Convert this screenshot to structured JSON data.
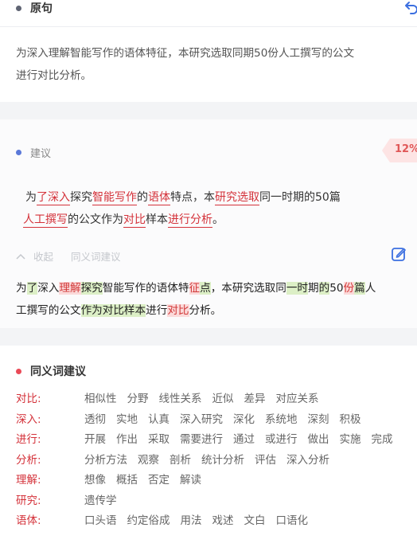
{
  "original": {
    "title": "原句",
    "lines": [
      "为深入理解智能写作的语体特征，本研究选取同期50份人工撰写的公文",
      "进行对比分析。"
    ]
  },
  "suggestion": {
    "label": "建议",
    "percent": "12%",
    "line1": [
      {
        "t": "为"
      },
      {
        "t": "了",
        "u": true
      },
      {
        "t": "深入",
        "u": true
      },
      {
        "t": "探究"
      },
      {
        "t": "智能写作",
        "u": true
      },
      {
        "t": "的"
      },
      {
        "t": "语体",
        "u": true
      },
      {
        "t": "特点，本"
      },
      {
        "t": "研究选取",
        "u": true
      },
      {
        "t": "同一时期的50篇"
      }
    ],
    "line2": [
      {
        "t": "人工撰写",
        "u": true
      },
      {
        "t": "的公文作为"
      },
      {
        "t": "对比",
        "u": true
      },
      {
        "t": "样本"
      },
      {
        "t": "进行分析",
        "u": true
      },
      {
        "t": "。"
      }
    ],
    "collapse_label": "收起",
    "synonym_tab_label": "同义词建议"
  },
  "diff": {
    "line1": [
      {
        "t": "为"
      },
      {
        "t": "了",
        "k": "ins"
      },
      {
        "t": "深入"
      },
      {
        "t": "理解",
        "k": "del"
      },
      {
        "t": "探究",
        "k": "ins"
      },
      {
        "t": "智能写作的语体特"
      },
      {
        "t": "征",
        "k": "del"
      },
      {
        "t": "点",
        "k": "ins"
      },
      {
        "t": "，本研究选取同"
      },
      {
        "t": "一时",
        "k": "ins"
      },
      {
        "t": "期"
      },
      {
        "t": "的",
        "k": "ins"
      },
      {
        "t": "50"
      },
      {
        "t": "份",
        "k": "del"
      },
      {
        "t": "篇",
        "k": "ins"
      },
      {
        "t": "人"
      }
    ],
    "line2": [
      {
        "t": "工撰写的公文"
      },
      {
        "t": "作为对比样本",
        "k": "ins"
      },
      {
        "t": "进行"
      },
      {
        "t": "对比",
        "k": "del"
      },
      {
        "t": "分析。"
      }
    ]
  },
  "synonyms": {
    "title": "同义词建议",
    "rows": [
      {
        "key": "对比:",
        "values": [
          "相似性",
          "分野",
          "线性关系",
          "近似",
          "差异",
          "对应关系"
        ]
      },
      {
        "key": "深入:",
        "values": [
          "透彻",
          "实地",
          "认真",
          "深入研究",
          "深化",
          "系统地",
          "深刻",
          "积极"
        ]
      },
      {
        "key": "进行:",
        "values": [
          "开展",
          "作出",
          "采取",
          "需要进行",
          "通过",
          "或进行",
          "做出",
          "实施",
          "完成"
        ]
      },
      {
        "key": "分析:",
        "values": [
          "分析方法",
          "观察",
          "剖析",
          "统计分析",
          "评估",
          "深入分析"
        ]
      },
      {
        "key": "理解:",
        "values": [
          "想像",
          "概括",
          "否定",
          "解读"
        ]
      },
      {
        "key": "研究:",
        "values": [
          "遗传学"
        ]
      },
      {
        "key": "语体:",
        "values": [
          "口头语",
          "约定俗成",
          "用法",
          "戏述",
          "文白",
          "口语化"
        ]
      }
    ]
  },
  "colors": {
    "accent_blue": "#3b6fe0",
    "dot_gray": "#5f6473",
    "dot_blue": "#5a78d8",
    "dot_red": "#ea4a57",
    "underline_red": "#d4323a",
    "insert_green_bg": "#dcefc6",
    "delete_red_bg": "#fbdada"
  },
  "icons": [
    "undo-icon",
    "chevron-up-icon",
    "edit-icon"
  ]
}
